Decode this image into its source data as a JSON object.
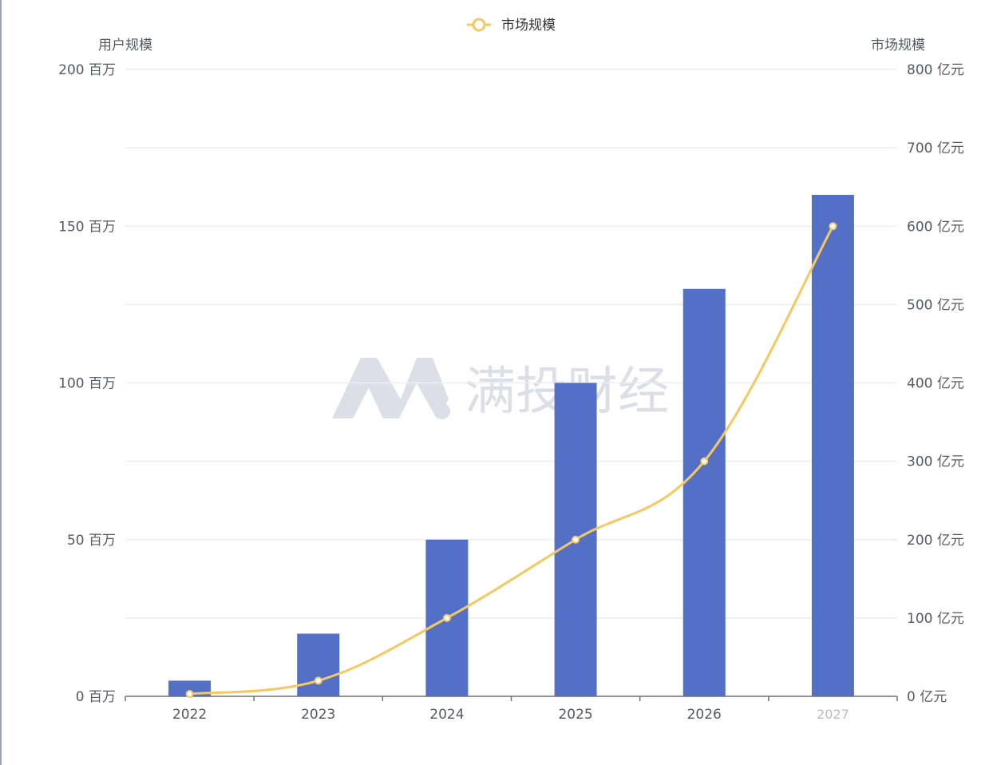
{
  "chart_data": {
    "type": "bar",
    "categories": [
      "2022",
      "2023",
      "2024",
      "2025",
      "2026",
      "2027"
    ],
    "series": [
      {
        "name": "用户规模",
        "type": "bar",
        "axis": "left",
        "values": [
          5,
          20,
          50,
          100,
          130,
          160
        ],
        "color": "#5470c6"
      },
      {
        "name": "市场规模",
        "type": "line",
        "axis": "right",
        "values": [
          3,
          20,
          100,
          200,
          300,
          600
        ],
        "color": "#f6c85f"
      }
    ],
    "legend": {
      "position": "top-center",
      "items": [
        "市场规模"
      ]
    },
    "y_left": {
      "label": "用户规模",
      "range": [
        0,
        200
      ],
      "ticks": [
        "0 百万",
        "50 百万",
        "100 百万",
        "150 百万",
        "200 百万"
      ],
      "tick_values": [
        0,
        50,
        100,
        150,
        200
      ]
    },
    "y_right": {
      "label": "市场规模",
      "range": [
        0,
        800
      ],
      "ticks": [
        "0 亿元",
        "100 亿元",
        "200 亿元",
        "300 亿元",
        "400 亿元",
        "500 亿元",
        "600 亿元",
        "700 亿元",
        "800 亿元"
      ],
      "tick_values": [
        0,
        100,
        200,
        300,
        400,
        500,
        600,
        700,
        800
      ]
    },
    "grid": true,
    "watermark": "满投财经",
    "last_category_label": "2027"
  }
}
